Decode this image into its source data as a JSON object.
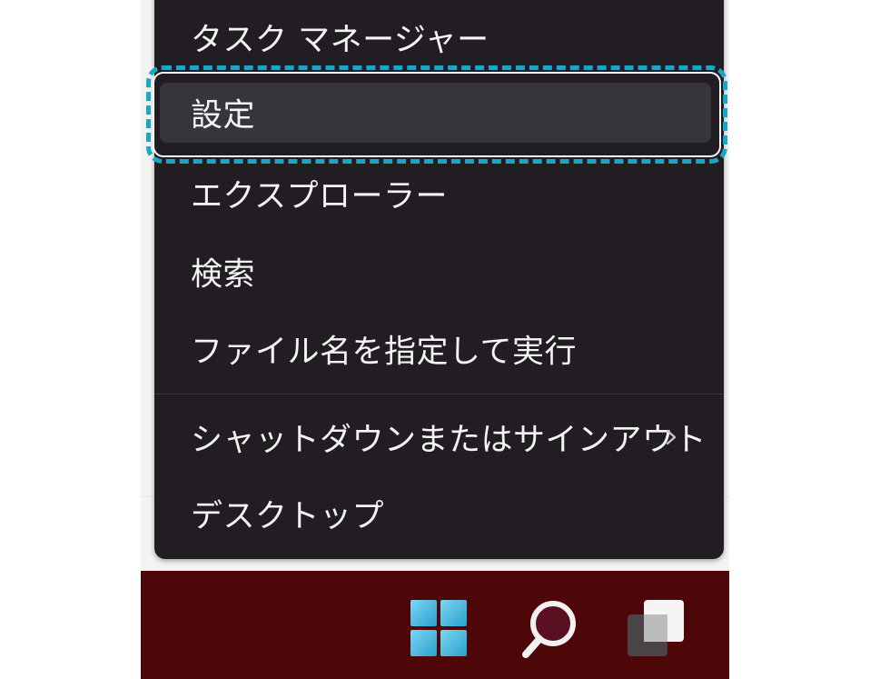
{
  "context_menu": {
    "items": [
      {
        "label": "タスク マネージャー"
      },
      {
        "label": "設定"
      },
      {
        "label": "エクスプローラー"
      },
      {
        "label": "検索"
      },
      {
        "label": "ファイル名を指定して実行"
      },
      {
        "label": "シャットダウンまたはサインアウト",
        "submenu_icon": "chevron-right-icon"
      },
      {
        "label": "デスクトップ"
      }
    ],
    "selected_index": 1
  },
  "taskbar": {
    "buttons": [
      "windows-start-icon",
      "search-icon",
      "task-view-icon"
    ]
  },
  "colors": {
    "menu_background": "#211d22",
    "selected_background": "#38343b",
    "highlight_frame": "#18a6c9",
    "taskbar_background": "#4d0708"
  }
}
